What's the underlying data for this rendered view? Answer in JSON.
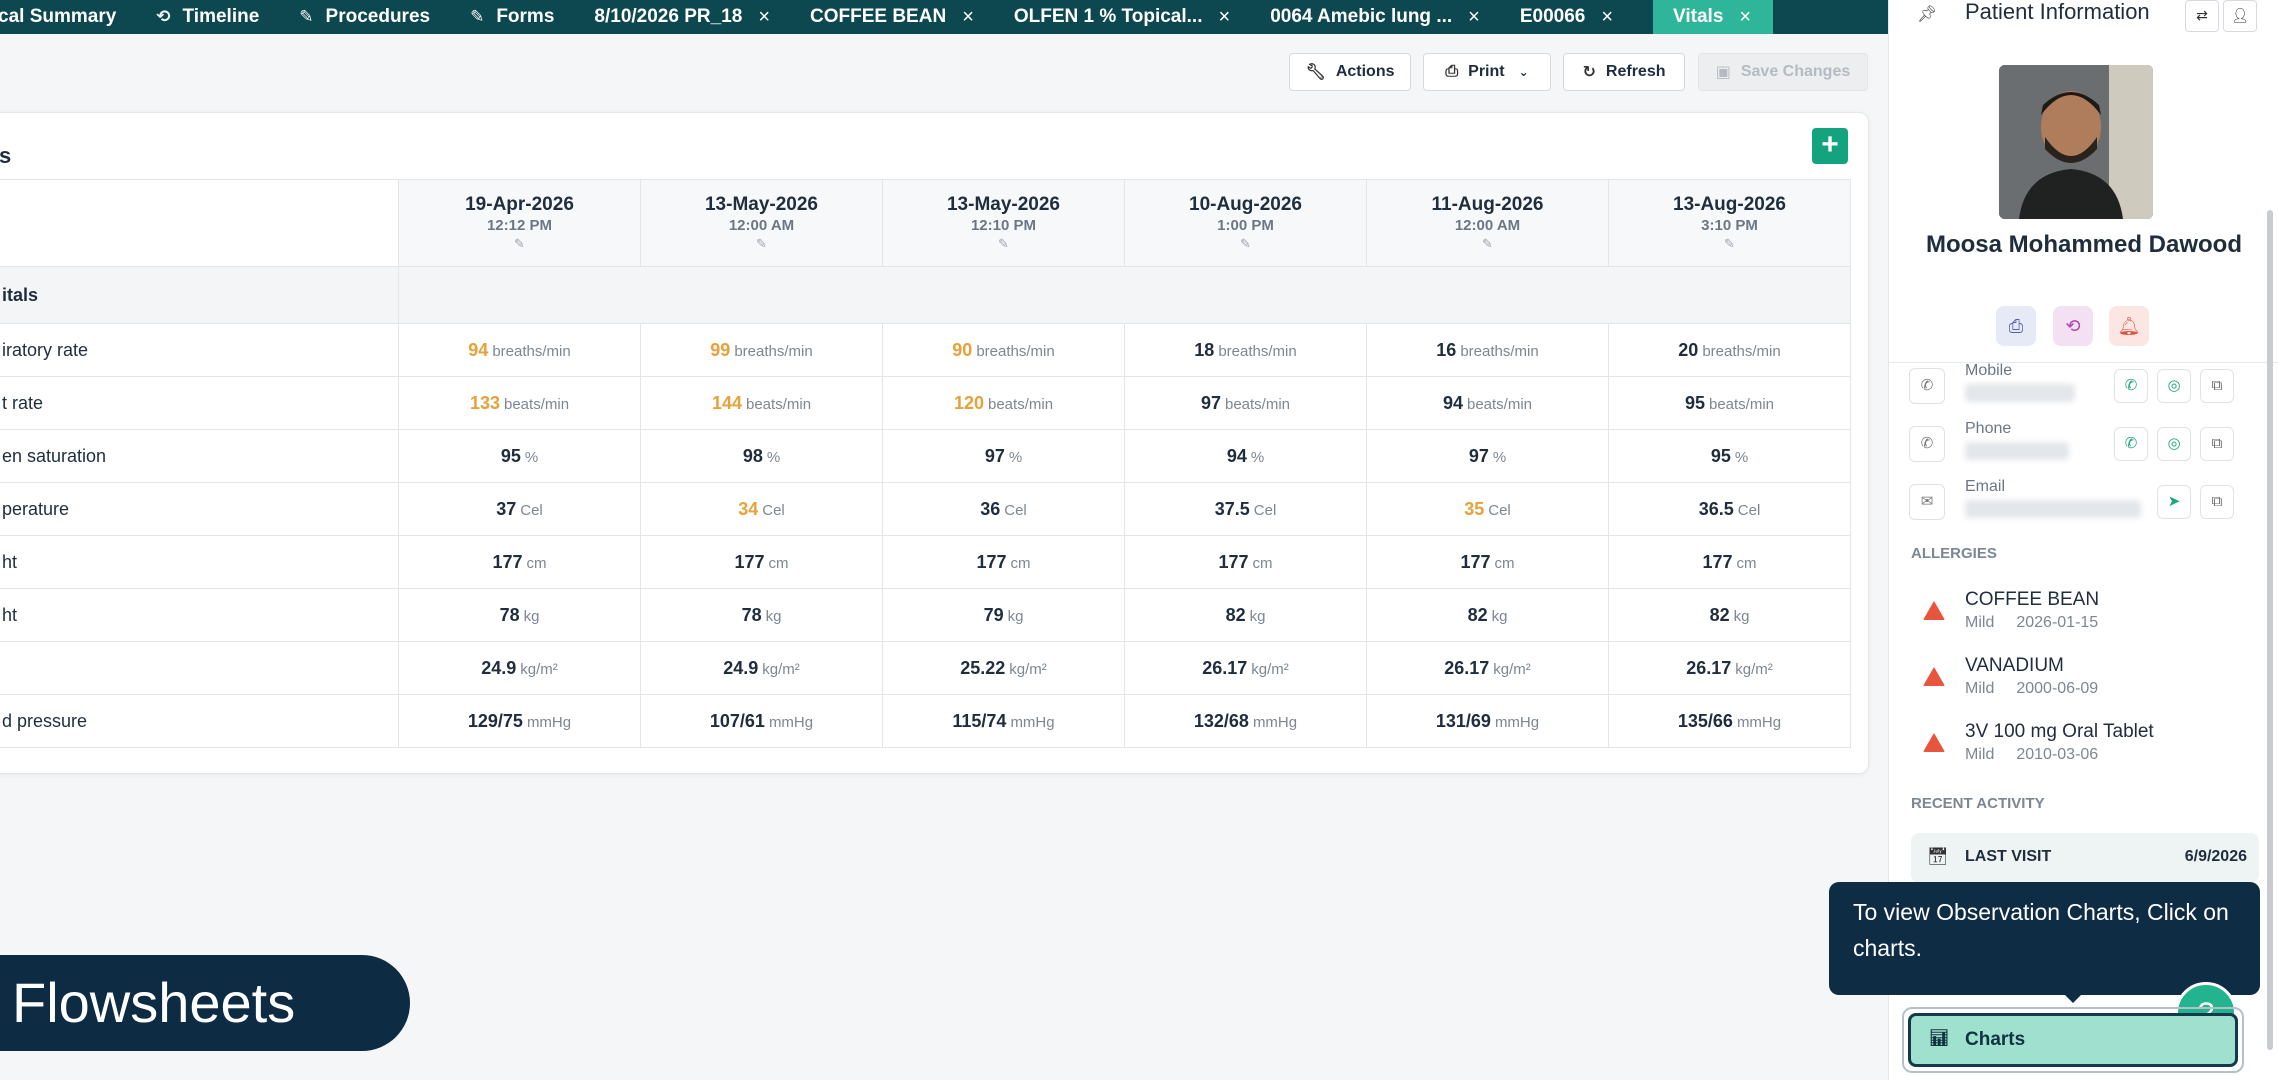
{
  "tabs": [
    {
      "label": "cal Summary",
      "icon": "none",
      "closable": false
    },
    {
      "label": "Timeline",
      "icon": "history-icon",
      "closable": false
    },
    {
      "label": "Procedures",
      "icon": "pen-icon",
      "closable": false
    },
    {
      "label": "Forms",
      "icon": "pen-icon",
      "closable": false
    },
    {
      "label": "8/10/2026 PR_18",
      "icon": "none",
      "closable": true
    },
    {
      "label": "COFFEE BEAN",
      "icon": "none",
      "closable": true
    },
    {
      "label": "OLFEN 1 % Topical...",
      "icon": "none",
      "closable": true
    },
    {
      "label": "0064 Amebic lung ...",
      "icon": "none",
      "closable": true
    },
    {
      "label": "E00066",
      "icon": "none",
      "closable": true
    },
    {
      "label": "Vitals",
      "icon": "none",
      "closable": true,
      "active": true
    }
  ],
  "toolbar": {
    "actions_label": "Actions",
    "print_label": "Print",
    "refresh_label": "Refresh",
    "save_label": "Save Changes"
  },
  "card": {
    "title": "s"
  },
  "vitals": {
    "section_label": "itals",
    "dates": [
      {
        "date": "19-Apr-2026",
        "time": "12:12 PM"
      },
      {
        "date": "13-May-2026",
        "time": "12:00 AM"
      },
      {
        "date": "13-May-2026",
        "time": "12:10 PM"
      },
      {
        "date": "10-Aug-2026",
        "time": "1:00 PM"
      },
      {
        "date": "11-Aug-2026",
        "time": "12:00 AM"
      },
      {
        "date": "13-Aug-2026",
        "time": "3:10 PM"
      }
    ],
    "rows": [
      {
        "label": "iratory rate",
        "unit": "breaths/min",
        "values": [
          "94",
          "99",
          "90",
          "18",
          "16",
          "20"
        ],
        "flags": [
          true,
          true,
          true,
          false,
          false,
          false
        ]
      },
      {
        "label": "t rate",
        "unit": "beats/min",
        "values": [
          "133",
          "144",
          "120",
          "97",
          "94",
          "95"
        ],
        "flags": [
          true,
          true,
          true,
          false,
          false,
          false
        ]
      },
      {
        "label": "en saturation",
        "unit": "%",
        "values": [
          "95",
          "98",
          "97",
          "94",
          "97",
          "95"
        ],
        "flags": [
          false,
          false,
          false,
          false,
          false,
          false
        ]
      },
      {
        "label": "perature",
        "unit": "Cel",
        "values": [
          "37",
          "34",
          "36",
          "37.5",
          "35",
          "36.5"
        ],
        "flags": [
          false,
          true,
          false,
          false,
          true,
          false
        ]
      },
      {
        "label": "ht",
        "unit": "cm",
        "values": [
          "177",
          "177",
          "177",
          "177",
          "177",
          "177"
        ],
        "flags": [
          false,
          false,
          false,
          false,
          false,
          false
        ]
      },
      {
        "label": "ht",
        "unit": "kg",
        "values": [
          "78",
          "78",
          "79",
          "82",
          "82",
          "82"
        ],
        "flags": [
          false,
          false,
          false,
          false,
          false,
          false
        ]
      },
      {
        "label": "",
        "unit": "kg/m²",
        "values": [
          "24.9",
          "24.9",
          "25.22",
          "26.17",
          "26.17",
          "26.17"
        ],
        "flags": [
          false,
          false,
          false,
          false,
          false,
          false
        ]
      },
      {
        "label": "d pressure",
        "unit": "mmHg",
        "values": [
          "129/75",
          "107/61",
          "115/74",
          "132/68",
          "131/69",
          "135/66"
        ],
        "flags": [
          false,
          false,
          false,
          false,
          false,
          false
        ]
      }
    ],
    "warn_color": "#e8a13a"
  },
  "panel": {
    "title": "Patient Information",
    "patient_name": "Moosa Mohammed Dawood",
    "contacts": [
      {
        "label": "Mobile",
        "icon": "phone-icon"
      },
      {
        "label": "Phone",
        "icon": "phone-icon"
      },
      {
        "label": "Email",
        "icon": "mail-icon"
      }
    ],
    "allergies_heading": "ALLERGIES",
    "allergies": [
      {
        "name": "COFFEE BEAN",
        "severity": "Mild",
        "date": "2026-01-15"
      },
      {
        "name": "VANADIUM",
        "severity": "Mild",
        "date": "2000-06-09"
      },
      {
        "name": "3V 100 mg Oral Tablet",
        "severity": "Mild",
        "date": "2010-03-06"
      }
    ],
    "recent_heading": "RECENT ACTIVITY",
    "last_visit_label": "LAST VISIT",
    "last_visit_value": "6/9/2026"
  },
  "tooltip": {
    "text": "To view Observation Charts, Click on charts."
  },
  "charts_button": {
    "label": "Charts"
  },
  "overlay": {
    "title": "Flowsheets"
  },
  "colors": {
    "tabbar": "#0d4850",
    "active_tab": "#2fb59a",
    "accent": "#14a37f",
    "tooltip": "#0f2c45"
  }
}
